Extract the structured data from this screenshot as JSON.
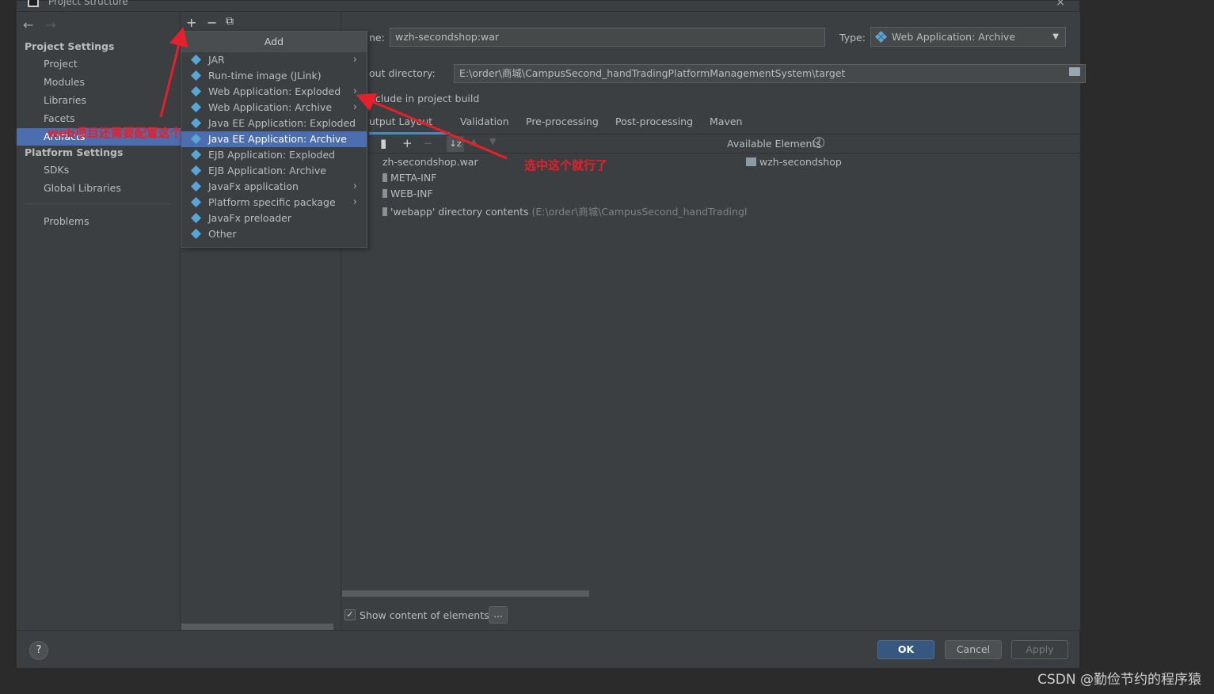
{
  "window": {
    "title": "Project Structure",
    "close_icon": "×"
  },
  "nav": {
    "back": "←",
    "forward": "→",
    "project_settings": "Project Settings",
    "project_items": [
      "Project",
      "Modules",
      "Libraries",
      "Facets",
      "Artifacts"
    ],
    "platform_settings": "Platform Settings",
    "platform_items": [
      "SDKs",
      "Global Libraries"
    ],
    "problems": "Problems"
  },
  "mid_toolbar": {
    "add": "+",
    "remove": "−",
    "copy": "⧉"
  },
  "popup": {
    "title": "Add",
    "items": [
      {
        "label": "JAR",
        "submenu": true
      },
      {
        "label": "Run-time image (JLink)",
        "submenu": false
      },
      {
        "label": "Web Application: Exploded",
        "submenu": true
      },
      {
        "label": "Web Application: Archive",
        "submenu": true
      },
      {
        "label": "Java EE Application: Exploded",
        "submenu": false
      },
      {
        "label": "Java EE Application: Archive",
        "submenu": false,
        "selected": true
      },
      {
        "label": "EJB Application: Exploded",
        "submenu": false
      },
      {
        "label": "EJB Application: Archive",
        "submenu": false
      },
      {
        "label": "JavaFx application",
        "submenu": true
      },
      {
        "label": "Platform specific package",
        "submenu": true
      },
      {
        "label": "JavaFx preloader",
        "submenu": false
      },
      {
        "label": "Other",
        "submenu": false
      }
    ]
  },
  "content": {
    "name_label": "ne:",
    "name_value": "wzh-secondshop:war",
    "type_label": "Type:",
    "type_value": "Web Application: Archive",
    "output_label": "out directory:",
    "output_value": "E:\\order\\商城\\CampusSecond_handTradingPlatformManagementSystem\\target",
    "include_label": "nclude in project build",
    "tabs": [
      "utput Layout",
      "Validation",
      "Pre-processing",
      "Post-processing",
      "Maven"
    ],
    "available_label": "Available Elements",
    "help_glyph": "?",
    "tree": {
      "root": "zh-secondshop.war",
      "children": [
        "META-INF",
        "WEB-INF"
      ],
      "webapp_label": "'webapp' directory contents",
      "webapp_path": "(E:\\order\\商城\\CampusSecond_handTradingI"
    },
    "available_items": [
      "wzh-secondshop"
    ],
    "show_content_label": "Show content of elements",
    "dots_label": "..."
  },
  "buttons": {
    "help": "?",
    "ok": "OK",
    "cancel": "Cancel",
    "apply": "Apply"
  },
  "annotations": {
    "left_note": "web项目还需要配置这个",
    "right_note": "选中这个就行了",
    "color": "#e5202a"
  },
  "watermark": "CSDN @勤俭节约的程序猿"
}
